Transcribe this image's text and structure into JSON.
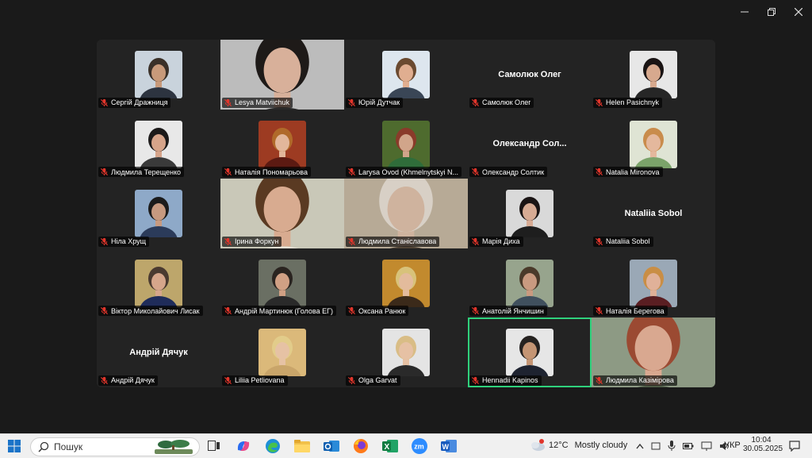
{
  "window": {
    "minimize_icon": "minimize-icon",
    "restore_icon": "restore-icon",
    "close_icon": "close-icon"
  },
  "accent_speaking": "#2fd17c",
  "participants": [
    {
      "name": "Сергій Дражниця",
      "kind": "photo",
      "bg": "#c9d3dc",
      "skin": "#c89a7a",
      "hair": "#3a3028",
      "shirt": "#2d3440"
    },
    {
      "name": "Lesya Matviichuk",
      "kind": "video",
      "bg": "#bcbcbc",
      "skin": "#d8b09a",
      "hair": "#1e1a18",
      "shirt": "#2a2a2a"
    },
    {
      "name": "Юрій Дутчак",
      "kind": "photo",
      "bg": "#dde6ee",
      "skin": "#e0ae90",
      "hair": "#6b4a30",
      "shirt": "#3a4656"
    },
    {
      "name": "Самолюк Олег",
      "kind": "text",
      "big": "Самолюк Олег"
    },
    {
      "name": "Helen Pasichnyk",
      "kind": "photo",
      "bg": "#e7e7e7",
      "skin": "#d7a98e",
      "hair": "#1a1414",
      "shirt": "#262626"
    },
    {
      "name": "Людмила Терещенко",
      "kind": "photo",
      "bg": "#e8e8e8",
      "skin": "#d6a48a",
      "hair": "#1c1a1a",
      "shirt": "#3a3a3a"
    },
    {
      "name": "Наталія Пономарьова",
      "kind": "photo",
      "bg": "#9d3b22",
      "skin": "#e2b79b",
      "hair": "#b06a2a",
      "shirt": "#5c1a12"
    },
    {
      "name": "Larysa Ovod (Khmelnytskyi N...",
      "kind": "photo",
      "bg": "#4e6b2e",
      "skin": "#d1a58a",
      "hair": "#8a3b2a",
      "shirt": "#2f6d3a"
    },
    {
      "name": "Олександр Солтик",
      "kind": "text",
      "big": "Олександр  Сол..."
    },
    {
      "name": "Natalia Mironova",
      "kind": "photo",
      "bg": "#dfe4d4",
      "skin": "#e4b89d",
      "hair": "#c98c4c",
      "shirt": "#7ba36a"
    },
    {
      "name": "Ніла Хрущ",
      "kind": "photo",
      "bg": "#8ea9c8",
      "skin": "#c79a80",
      "hair": "#1b1b1b",
      "shirt": "#2b3b5a"
    },
    {
      "name": "Ірина Форкун",
      "kind": "video",
      "bg": "#c9c8b8",
      "skin": "#d8ab90",
      "hair": "#5a3a22",
      "shirt": "#e6e1d6"
    },
    {
      "name": "Людмила Станіславова",
      "kind": "video",
      "bg": "#b7aa96",
      "skin": "#cfb39e",
      "hair": "#d8d0c6",
      "shirt": "#514436"
    },
    {
      "name": "Марія Диха",
      "kind": "photo",
      "bg": "#d9d9d9",
      "skin": "#d7ab94",
      "hair": "#1a1414",
      "shirt": "#1e1e1e"
    },
    {
      "name": "Nataliia Sobol",
      "kind": "text",
      "big": "Nataliia Sobol"
    },
    {
      "name": "Віктор Миколайович Лисак",
      "kind": "photo",
      "bg": "#bda66b",
      "skin": "#d6a68b",
      "hair": "#4a3a30",
      "shirt": "#1f2c5a"
    },
    {
      "name": "Андрій Мартинюк (Голова ЕГ)",
      "kind": "photo",
      "bg": "#6a6f63",
      "skin": "#d0a084",
      "hair": "#2a2420",
      "shirt": "#2a2a2a"
    },
    {
      "name": "Оксана Ранюк",
      "kind": "photo",
      "bg": "#c28a2e",
      "skin": "#e3bb9c",
      "hair": "#d8c27a",
      "shirt": "#3b2a1a"
    },
    {
      "name": "Анатолій Янчишин",
      "kind": "photo",
      "bg": "#97a48d",
      "skin": "#c99a80",
      "hair": "#4a3a2a",
      "shirt": "#40505e"
    },
    {
      "name": "Наталія Берегова",
      "kind": "photo",
      "bg": "#9aa8b6",
      "skin": "#e0b199",
      "hair": "#c98e45",
      "shirt": "#5a1e22"
    },
    {
      "name": "Андрій Дячук",
      "kind": "text",
      "big": "Андрій Дячук"
    },
    {
      "name": "Liliia Petliovana",
      "kind": "photo",
      "bg": "#dbb97a",
      "skin": "#e6c2a4",
      "hair": "#e2cc8a",
      "shirt": "#c9a56a"
    },
    {
      "name": "Olga Garvat",
      "kind": "photo",
      "bg": "#e4e4e4",
      "skin": "#e6c1a4",
      "hair": "#d9bd86",
      "shirt": "#2a2a2a"
    },
    {
      "name": "Hennadii Kapinos",
      "kind": "photo",
      "bg": "#e6e6e6",
      "skin": "#c49574",
      "hair": "#252220",
      "shirt": "#1e2330",
      "speaking": true
    },
    {
      "name": "Людмила Казімірова",
      "kind": "video",
      "bg": "#8d9a84",
      "skin": "#d9a890",
      "hair": "#9b4a32",
      "shirt": "#4c5a45"
    }
  ],
  "taskbar": {
    "search_placeholder": "Пошук",
    "apps": [
      "task-view-icon",
      "copilot-icon",
      "edge-icon",
      "file-explorer-icon",
      "outlook-icon",
      "firefox-icon",
      "excel-icon",
      "zoom-icon",
      "word-icon"
    ],
    "weather_temp": "12°C",
    "weather_desc": "Mostly cloudy",
    "language": "УКР",
    "time": "10:04",
    "date": "30.05.2025"
  }
}
